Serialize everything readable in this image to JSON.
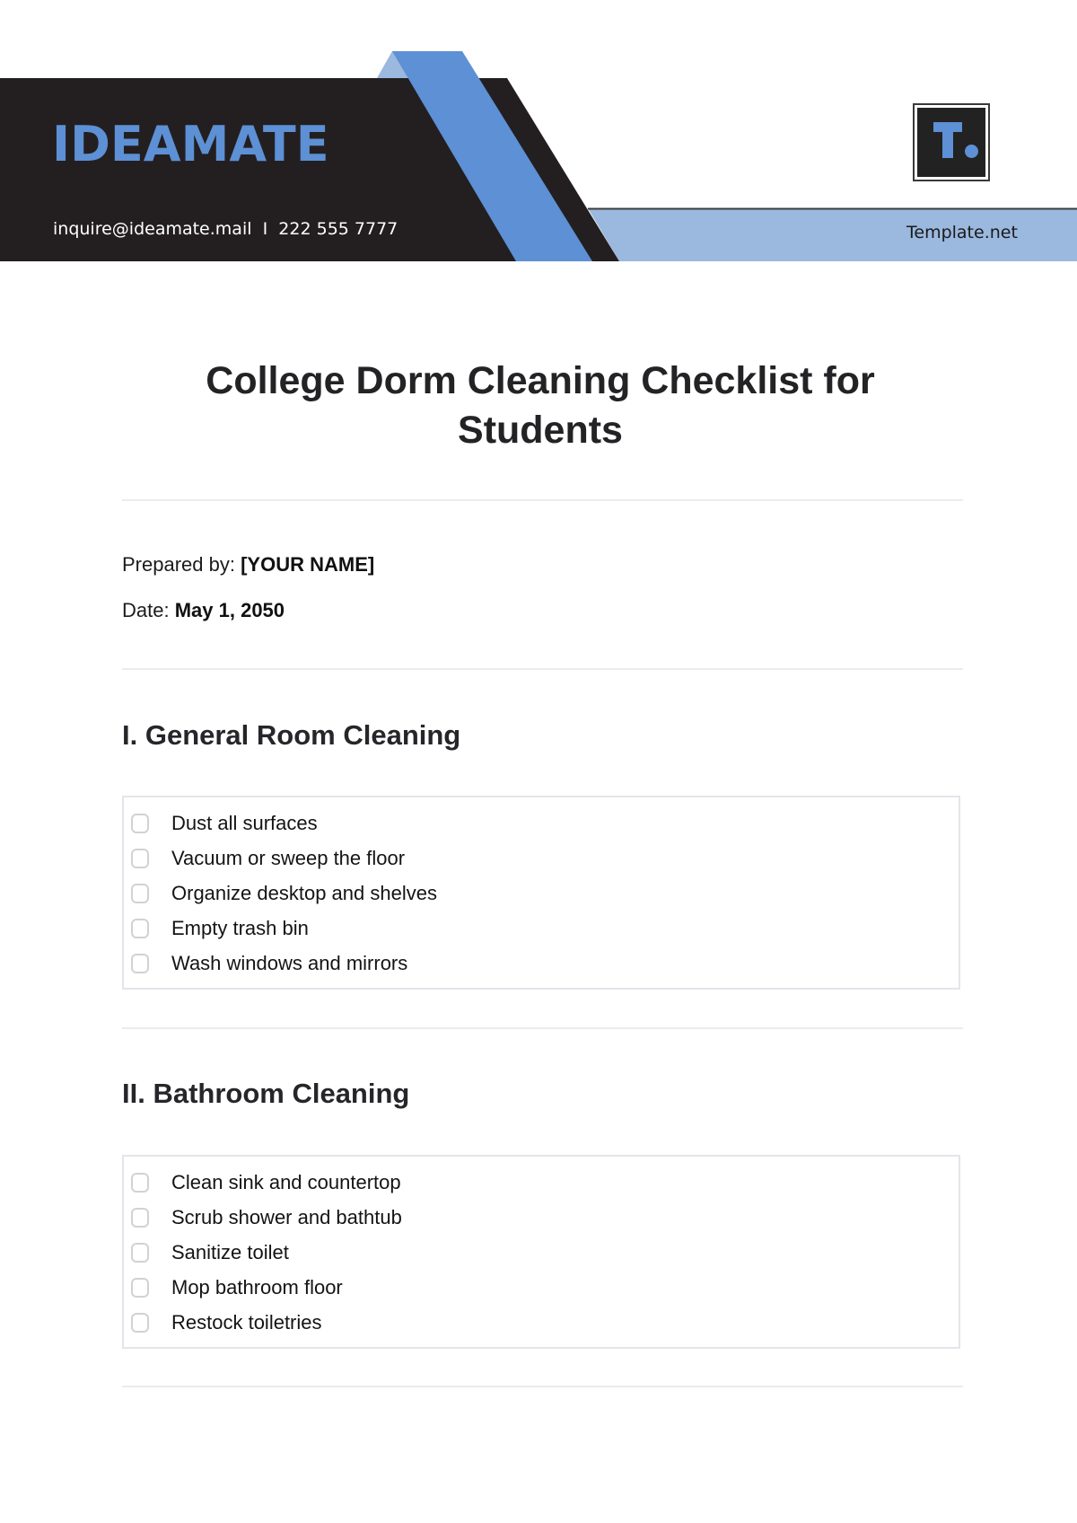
{
  "header": {
    "brand": "IDEAMATE",
    "email": "inquire@ideamate.mail",
    "separator": "I",
    "phone": "222 555 7777",
    "logo_letter": "T.",
    "site": "Template.net",
    "colors": {
      "dark": "#231f20",
      "accent_blue": "#5d90d4",
      "light_blue": "#9bb8de"
    }
  },
  "document": {
    "title": "College Dorm Cleaning Checklist for Students",
    "prepared_by_label": "Prepared by:",
    "prepared_by_value": "[YOUR NAME]",
    "date_label": "Date:",
    "date_value": "May 1, 2050"
  },
  "sections": [
    {
      "heading": "I. General Room Cleaning",
      "items": [
        {
          "label": "Dust all surfaces",
          "checked": false
        },
        {
          "label": "Vacuum or sweep the floor",
          "checked": false
        },
        {
          "label": "Organize desktop and shelves",
          "checked": false
        },
        {
          "label": "Empty trash bin",
          "checked": false
        },
        {
          "label": "Wash windows and mirrors",
          "checked": false
        }
      ]
    },
    {
      "heading": "II. Bathroom Cleaning",
      "items": [
        {
          "label": "Clean sink and countertop",
          "checked": false
        },
        {
          "label": "Scrub shower and bathtub",
          "checked": false
        },
        {
          "label": "Sanitize toilet",
          "checked": false
        },
        {
          "label": "Mop bathroom floor",
          "checked": false
        },
        {
          "label": "Restock toiletries",
          "checked": false
        }
      ]
    }
  ]
}
